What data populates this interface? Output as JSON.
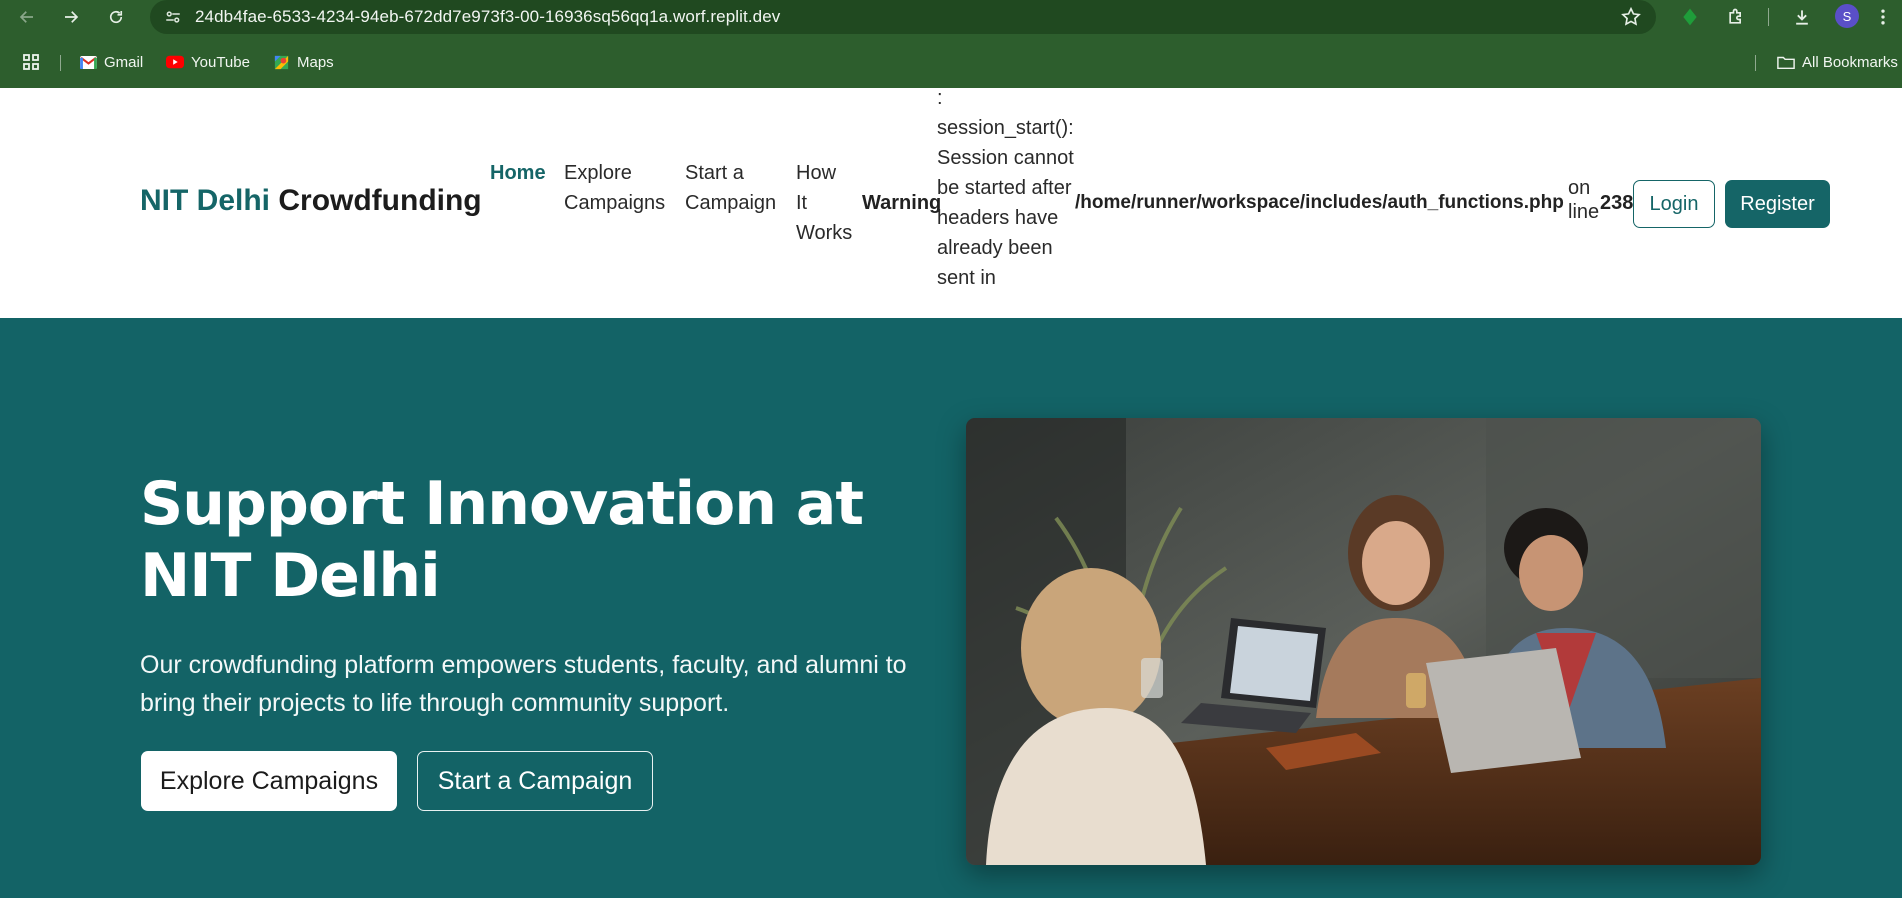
{
  "browser": {
    "url": "24db4fae-6533-4234-94eb-672dd7e973f3-00-16936sq56qq1a.worf.replit.dev",
    "profile_initial": "S",
    "bookmarks": [
      {
        "label": "Gmail",
        "icon": "gmail-icon"
      },
      {
        "label": "YouTube",
        "icon": "youtube-icon"
      },
      {
        "label": "Maps",
        "icon": "maps-icon"
      }
    ],
    "all_bookmarks_label": "All Bookmarks"
  },
  "site": {
    "brand_accent": "NIT Delhi",
    "brand_rest": " Crowdfunding",
    "nav": {
      "home": "Home",
      "explore_1": "Explore",
      "explore_2": "Campaigns",
      "start_1": "Start a",
      "start_2": "Campaign",
      "how_1": "How",
      "how_2": "It",
      "how_3": "Works"
    },
    "warning": {
      "label": "Warning",
      "lines": [
        ":",
        "session_start():",
        "Session cannot",
        "be started after",
        "headers have",
        "already been",
        "sent in"
      ],
      "path": "/home/runner/workspace/includes/auth_functions.php",
      "on_1": "on",
      "on_2": "line",
      "line_number": "238"
    },
    "login_label": "Login",
    "register_label": "Register"
  },
  "hero": {
    "title": "Support Innovation at NIT Delhi",
    "subtitle": "Our crowdfunding platform empowers students, faculty, and alumni to bring their projects to life through community support.",
    "explore_button": "Explore Campaigns",
    "start_button": "Start a Campaign"
  },
  "colors": {
    "chrome_bg": "#2d5e2d",
    "brand_teal": "#156567",
    "hero_bg": "#136366"
  }
}
